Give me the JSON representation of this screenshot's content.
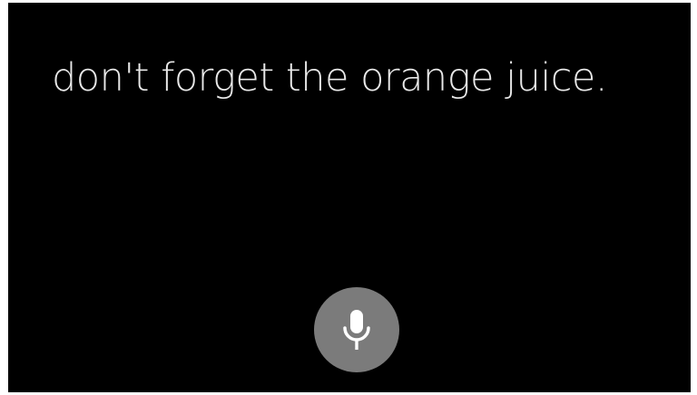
{
  "transcript": {
    "text": "don't forget the orange juice."
  },
  "mic_button": {
    "icon": "microphone-icon",
    "background_color": "#7b7b7b",
    "icon_color": "#ffffff"
  },
  "colors": {
    "background": "#000000",
    "text": "#e8e8e8"
  }
}
